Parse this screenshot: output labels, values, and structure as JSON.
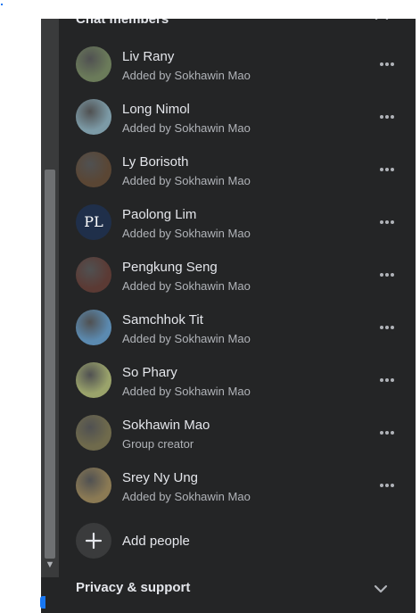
{
  "section": {
    "title": "Chat members"
  },
  "members": [
    {
      "name": "Liv Rany",
      "subtitle": "Added by Sokhawin Mao",
      "avatar_color": "#6b7b5a"
    },
    {
      "name": "Long Nimol",
      "subtitle": "Added by Sokhawin Mao",
      "avatar_color": "#7c9aa6"
    },
    {
      "name": "Ly Borisoth",
      "subtitle": "Added by Sokhawin Mao",
      "avatar_color": "#5a4634"
    },
    {
      "name": "Paolong Lim",
      "subtitle": "Added by Sokhawin Mao",
      "avatar_color": "#1f2f4a",
      "avatar_initials": "PL"
    },
    {
      "name": "Pengkung Seng",
      "subtitle": "Added by Sokhawin Mao",
      "avatar_color": "#5b3a34"
    },
    {
      "name": "Samchhok Tit",
      "subtitle": "Added by Sokhawin Mao",
      "avatar_color": "#5b8ab0"
    },
    {
      "name": "So Phary",
      "subtitle": "Added by Sokhawin Mao",
      "avatar_color": "#9aa36b"
    },
    {
      "name": "Sokhawin Mao",
      "subtitle": "Group creator",
      "avatar_color": "#6f6a4c"
    },
    {
      "name": "Srey Ny Ung",
      "subtitle": "Added by Sokhawin Mao",
      "avatar_color": "#8b7a54"
    }
  ],
  "add_people": {
    "label": "Add people"
  },
  "privacy": {
    "title": "Privacy & support"
  },
  "colors": {
    "panel_bg": "#242526",
    "primary_text": "#e4e6eb",
    "secondary_text": "#b0b3b8",
    "accent": "#1877f2"
  }
}
